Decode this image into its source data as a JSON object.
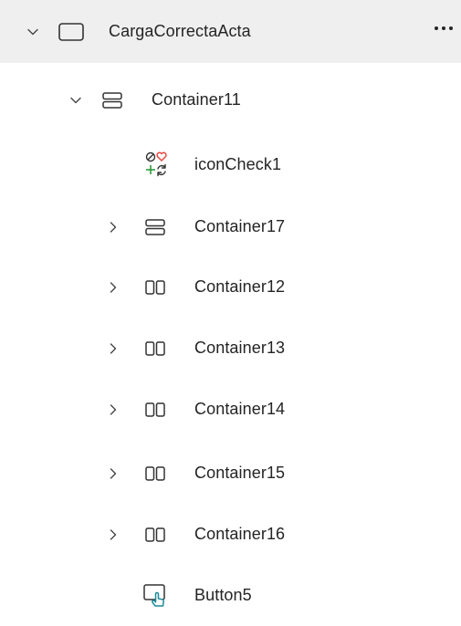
{
  "tree": {
    "root": {
      "label": "CargaCorrectaActa",
      "expanded": true,
      "icon": "screen-icon"
    },
    "container11": {
      "label": "Container11",
      "expanded": true,
      "icon": "vertical-container-icon"
    },
    "children": [
      {
        "label": "iconCheck1",
        "icon": "icon-set-icon"
      },
      {
        "label": "Container17",
        "icon": "vertical-container-icon",
        "expanded": false
      },
      {
        "label": "Container12",
        "icon": "horizontal-container-icon",
        "expanded": false
      },
      {
        "label": "Container13",
        "icon": "horizontal-container-icon",
        "expanded": false
      },
      {
        "label": "Container14",
        "icon": "horizontal-container-icon",
        "expanded": false
      },
      {
        "label": "Container15",
        "icon": "horizontal-container-icon",
        "expanded": false
      },
      {
        "label": "Container16",
        "icon": "horizontal-container-icon",
        "expanded": false
      },
      {
        "label": "Button5",
        "icon": "button-icon"
      }
    ]
  },
  "colors": {
    "selected_row": "#efefef",
    "text": "#242424",
    "icon_red": "#e8473d",
    "icon_green": "#2e9b3a",
    "button_teal": "#1b8a9a"
  }
}
